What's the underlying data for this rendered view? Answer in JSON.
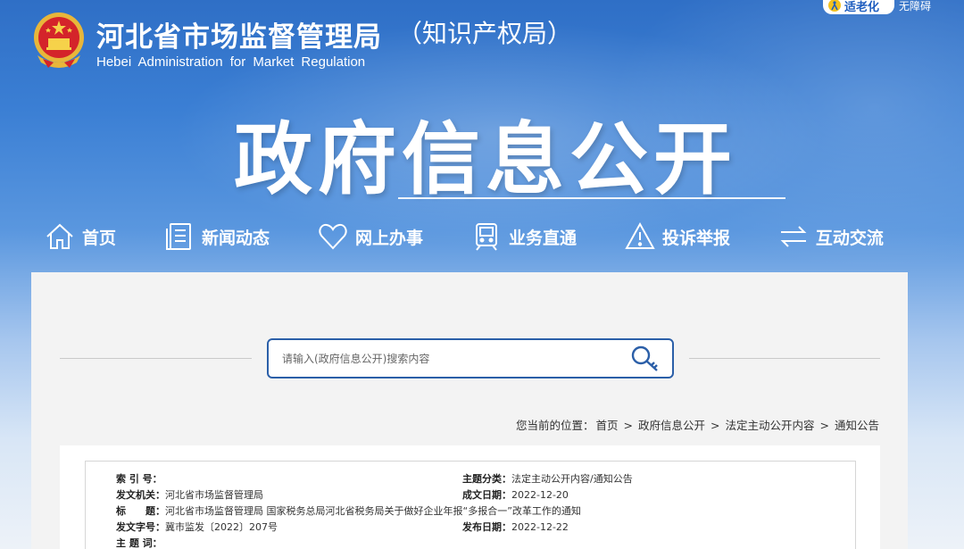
{
  "header": {
    "title": "河北省市场监督管理局",
    "title_suffix": "（知识产权局）",
    "title_en": "Hebei Administration for Market Regulation",
    "elder_mode_label": "适老化",
    "accessibility_label": "无障碍"
  },
  "banner": {
    "title": "政府信息公开"
  },
  "nav": {
    "items": [
      {
        "label": "首页",
        "icon": "home-icon"
      },
      {
        "label": "新闻动态",
        "icon": "document-icon"
      },
      {
        "label": "网上办事",
        "icon": "heart-icon"
      },
      {
        "label": "业务直通",
        "icon": "train-icon"
      },
      {
        "label": "投诉举报",
        "icon": "warning-icon"
      },
      {
        "label": "互动交流",
        "icon": "exchange-icon"
      }
    ]
  },
  "search": {
    "placeholder": "请输入(政府信息公开)搜索内容",
    "value": ""
  },
  "breadcrumb": {
    "prefix": "您当前的位置：",
    "items": [
      "首页",
      "政府信息公开",
      "法定主动公开内容",
      "通知公告"
    ]
  },
  "info": {
    "index_no_label": "索 引 号：",
    "index_no": "",
    "category_label": "主题分类：",
    "category": "法定主动公开内容/通知公告",
    "issuer_label": "发文机关：",
    "issuer": "河北省市场监督管理局",
    "date_created_label": "成文日期：",
    "date_created": "2022-12-20",
    "subject_label": "标　　题：",
    "subject": "河北省市场监督管理局 国家税务总局河北省税务局关于做好企业年报“多报合一”改革工作的通知",
    "doc_no_label": "发文字号：",
    "doc_no": "冀市监发〔2022〕207号",
    "date_published_label": "发布日期：",
    "date_published": "2022-12-22",
    "keywords_label": "主 题 词：",
    "keywords": ""
  },
  "colors": {
    "header_blue": "#2f6fc6",
    "search_border": "#2b5fa8",
    "elder_text": "#1d5cbf"
  }
}
